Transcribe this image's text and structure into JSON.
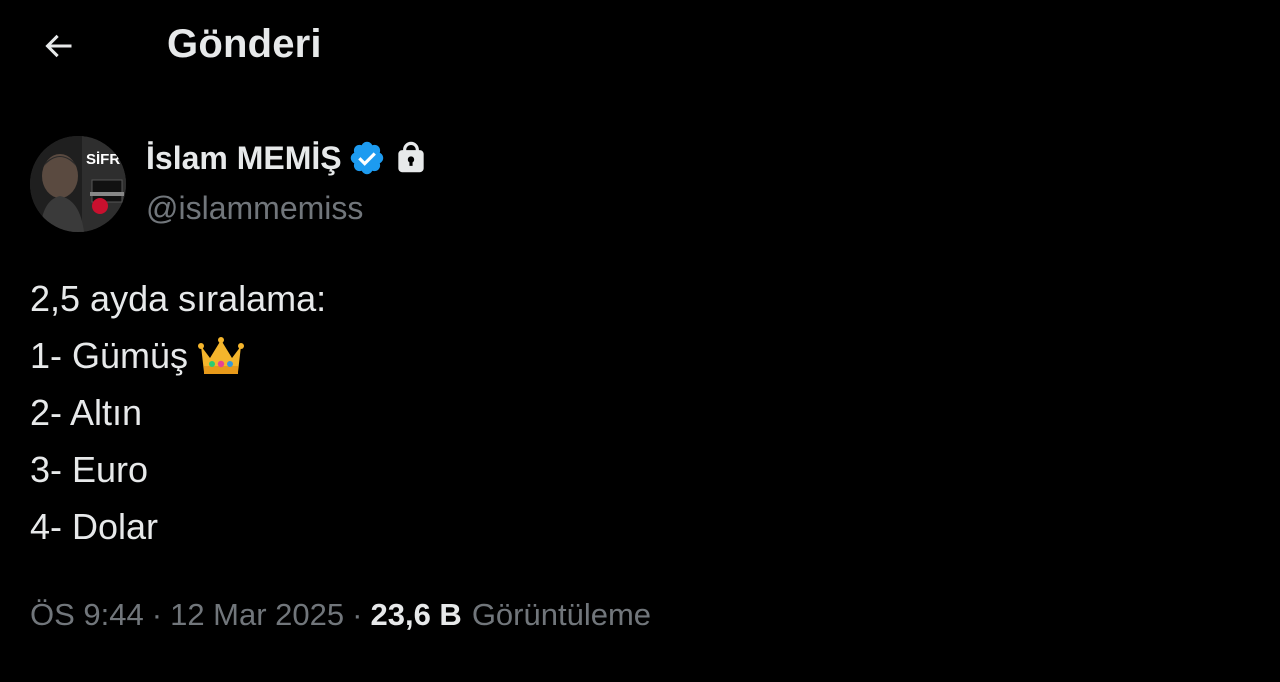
{
  "header": {
    "title": "Gönderi",
    "back_icon": "arrow-left-icon"
  },
  "author": {
    "display_name": "İslam MEMİŞ",
    "handle": "@islammemiss",
    "verified_icon": "verified-badge-icon",
    "lock_icon": "lock-icon",
    "avatar_text": "SİFR",
    "verified_color": "#1d9bf0"
  },
  "tweet": {
    "lines": [
      "2,5 ayda sıralama:",
      "1- Gümüş",
      "2- Altın",
      "3- Euro",
      "4- Dolar"
    ],
    "emoji": "crown-icon"
  },
  "meta": {
    "time": "ÖS 9:44",
    "separator": "·",
    "date": "12 Mar 2025",
    "views_count": "23,6 B",
    "views_label": "Görüntüleme"
  },
  "colors": {
    "background": "#000000",
    "text": "#e7e9ea",
    "muted": "#71767b"
  }
}
